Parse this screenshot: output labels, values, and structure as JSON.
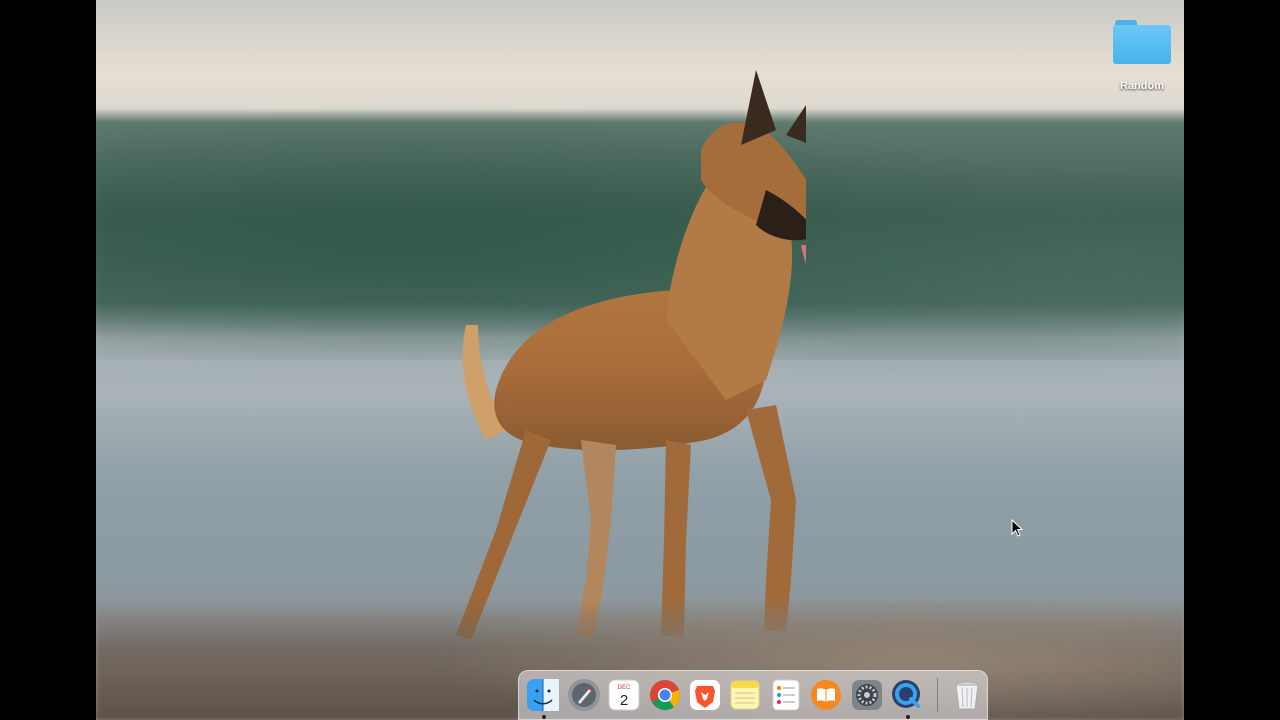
{
  "desktop": {
    "icons": [
      {
        "label": "Random",
        "icon": "folder-icon"
      }
    ]
  },
  "dock": {
    "items": [
      {
        "name": "finder",
        "icon": "finder-icon",
        "running": true
      },
      {
        "name": "launchpad",
        "icon": "launchpad-icon",
        "running": false
      },
      {
        "name": "calendar",
        "icon": "calendar-icon",
        "running": false,
        "month": "DEC",
        "day": "2"
      },
      {
        "name": "chrome",
        "icon": "chrome-icon",
        "running": false
      },
      {
        "name": "brave",
        "icon": "brave-icon",
        "running": false
      },
      {
        "name": "notes",
        "icon": "notes-icon",
        "running": false
      },
      {
        "name": "reminders",
        "icon": "reminders-icon",
        "running": false
      },
      {
        "name": "books",
        "icon": "books-icon",
        "running": false
      },
      {
        "name": "system-preferences",
        "icon": "gear-icon",
        "running": false
      },
      {
        "name": "quicktime",
        "icon": "quicktime-icon",
        "running": true
      },
      {
        "name": "trash",
        "icon": "trash-icon",
        "running": false
      }
    ]
  },
  "colors": {
    "folder": "#5bbcf0",
    "dock_bg": "#ebebee"
  }
}
